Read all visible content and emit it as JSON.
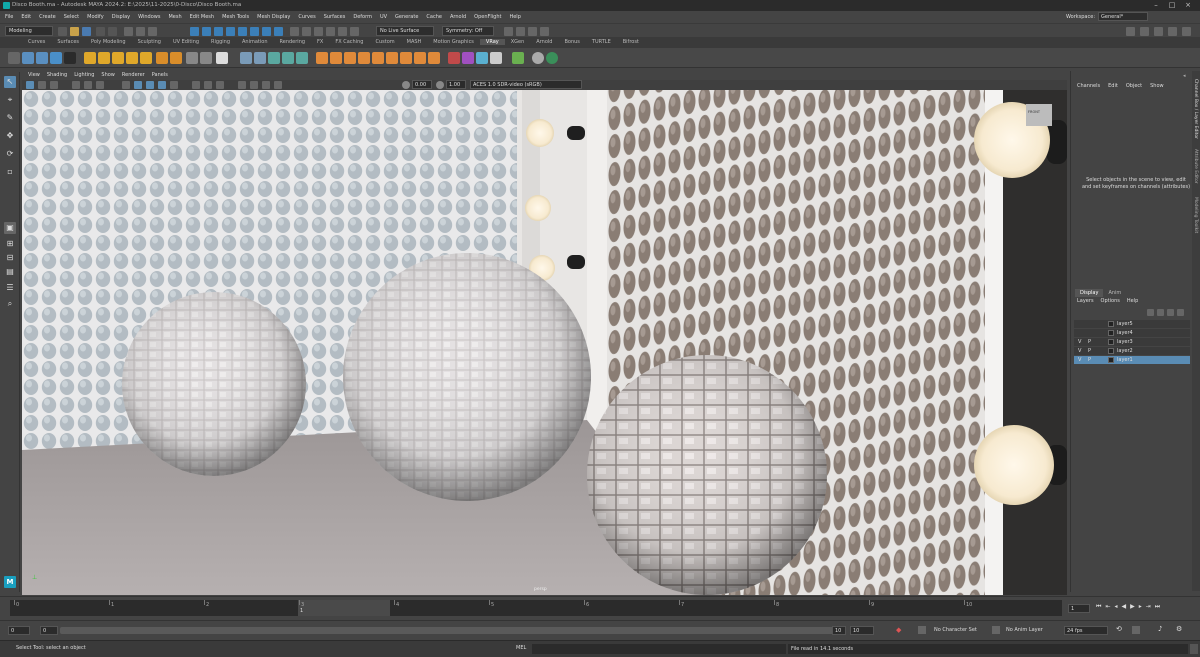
{
  "window": {
    "title": "Disco Booth.ma - Autodesk MAYA 2024.2: E:\\2025\\11-2025\\0-Disco\\Disco Booth.ma",
    "controls": [
      "–",
      "□",
      "×"
    ]
  },
  "menubar": {
    "items": [
      "File",
      "Edit",
      "Create",
      "Select",
      "Modify",
      "Display",
      "Windows",
      "Mesh",
      "Edit Mesh",
      "Mesh Tools",
      "Mesh Display",
      "Curves",
      "Surfaces",
      "Deform",
      "UV",
      "Generate",
      "Cache",
      "Arnold",
      "OpenFlight",
      "Help"
    ],
    "workspace_label": "Workspace:",
    "workspace_value": "General*"
  },
  "statusline": {
    "mode": "Modeling",
    "live_surface": "No Live Surface",
    "symmetry": "Symmetry: Off"
  },
  "shelf": {
    "tabs": [
      "Curves",
      "Surfaces",
      "Poly Modeling",
      "Sculpting",
      "UV Editing",
      "Rigging",
      "Animation",
      "Rendering",
      "FX",
      "FX Caching",
      "Custom",
      "MASH",
      "Motion Graphics",
      "VRay",
      "XGen",
      "Arnold",
      "Bonus",
      "TURTLE",
      "Bifrost"
    ],
    "active_tab": "VRay"
  },
  "viewport": {
    "menu": [
      "View",
      "Shading",
      "Lighting",
      "Show",
      "Renderer",
      "Panels"
    ],
    "exposure": "0.00",
    "gamma": "1.00",
    "color_transform": "ACES 1.0 SDR-video (sRGB)",
    "camera_label": "persp",
    "hint": "FRONT"
  },
  "channelbox": {
    "menu": [
      "Channels",
      "Edit",
      "Object",
      "Show"
    ],
    "message": "Select objects in the scene to view, edit and set keyframes on channels (attributes)"
  },
  "sidetabs": [
    "Channel Box / Layer Editor",
    "Attribute Editor",
    "Modeling Toolkit"
  ],
  "layereditor": {
    "tabs": [
      "Display",
      "Anim"
    ],
    "active_tab": "Display",
    "menu": [
      "Layers",
      "Options",
      "Help"
    ],
    "layers": [
      {
        "v": "",
        "p": "",
        "name": "layer5",
        "selected": false
      },
      {
        "v": "",
        "p": "",
        "name": "layer4",
        "selected": false
      },
      {
        "v": "V",
        "p": "P",
        "name": "layer3",
        "selected": false
      },
      {
        "v": "V",
        "p": "P",
        "name": "layer2",
        "selected": false
      },
      {
        "v": "V",
        "p": "P",
        "name": "layer1",
        "selected": true
      }
    ]
  },
  "timeslider": {
    "ticks": [
      "0",
      "1",
      "2",
      "3",
      "4",
      "5",
      "6",
      "7",
      "8",
      "9",
      "10"
    ],
    "current_frame": "1",
    "field_value": "1"
  },
  "rangeslider": {
    "start": "0",
    "anim_start": "0",
    "anim_end": "10",
    "end": "10",
    "character_set": "No Character Set",
    "anim_layer": "No Anim Layer",
    "fps": "24 fps"
  },
  "commandline": {
    "mode": "MEL",
    "feedback": "File read in  14.1 seconds",
    "help": "Select Tool: select an object"
  }
}
